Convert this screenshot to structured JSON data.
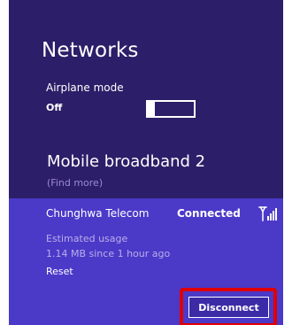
{
  "networks": {
    "title": "Networks",
    "airplane_mode": {
      "label": "Airplane mode",
      "state": "Off",
      "enabled": false
    },
    "mobile_broadband": {
      "title": "Mobile broadband 2",
      "find_more": "(Find more)",
      "carrier": "Chunghwa Telecom",
      "status": "Connected",
      "estimated_usage_label": "Estimated usage",
      "estimated_usage_value": "1.14 MB since 1 hour ago",
      "reset_label": "Reset",
      "disconnect_label": "Disconnect",
      "signal_icon": "mobile-signal-icon"
    }
  },
  "colors": {
    "panel_bg": "#2c1e68",
    "connection_bg": "#4b39c8",
    "text": "#ffffff",
    "link_text": "#9b8ad8",
    "usage_text": "#b9afe8",
    "highlight": "#e10000"
  }
}
